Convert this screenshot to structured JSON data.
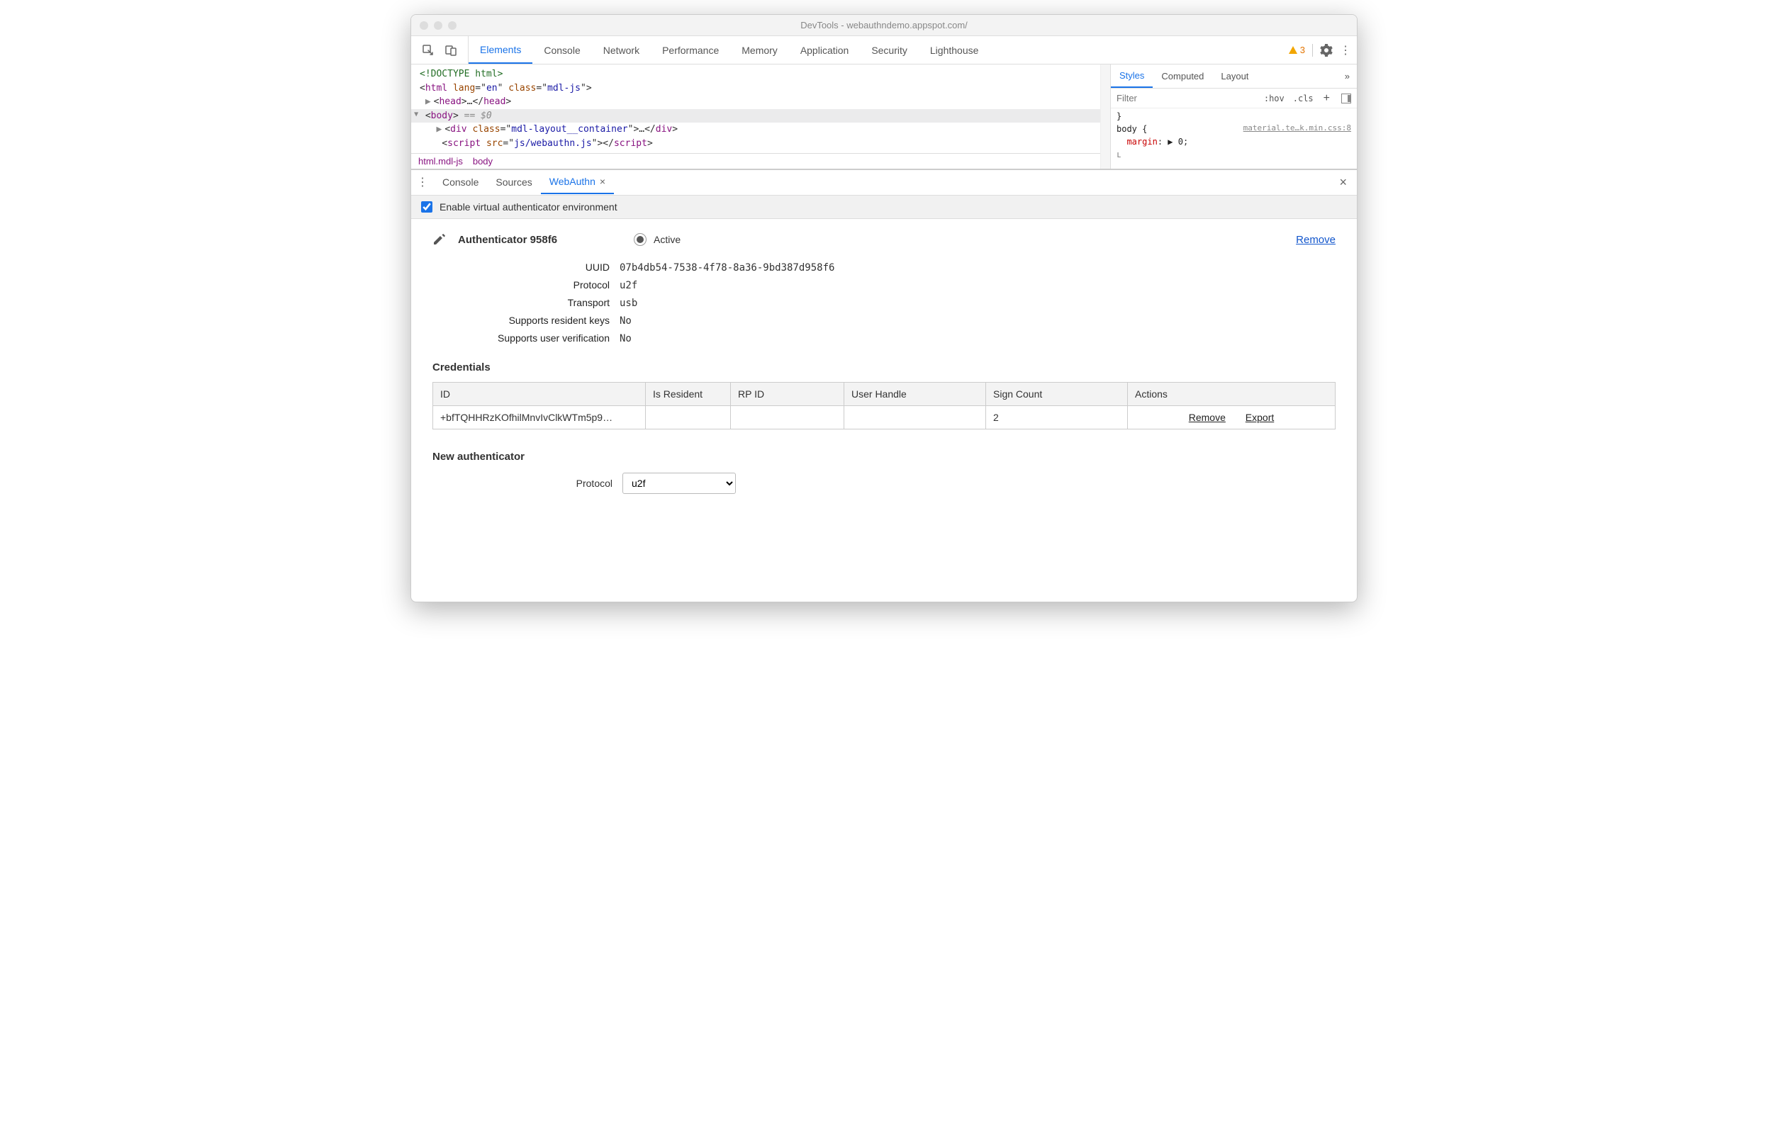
{
  "window": {
    "title": "DevTools - webauthndemo.appspot.com/"
  },
  "toolbar": {
    "tabs": [
      "Elements",
      "Console",
      "Network",
      "Performance",
      "Memory",
      "Application",
      "Security",
      "Lighthouse"
    ],
    "active": "Elements",
    "warning_count": "3"
  },
  "dom": {
    "line1": "<!DOCTYPE html>",
    "html_lang": "en",
    "html_class": "mdl-js",
    "body_sel": "== $0",
    "div_class": "mdl-layout__container",
    "script_src": "js/webauthn.js"
  },
  "breadcrumb": [
    "html.mdl-js",
    "body"
  ],
  "styles": {
    "tabs": [
      "Styles",
      "Computed",
      "Layout"
    ],
    "active": "Styles",
    "filter_placeholder": "Filter",
    "hov": ":hov",
    "cls": ".cls",
    "source": "material.te…k.min.css:8",
    "selector": "body",
    "prop": "margin",
    "val": "▶ 0"
  },
  "drawer": {
    "tabs": [
      "Console",
      "Sources",
      "WebAuthn"
    ],
    "active": "WebAuthn",
    "enable_label": "Enable virtual authenticator environment"
  },
  "auth": {
    "title": "Authenticator 958f6",
    "active_label": "Active",
    "remove": "Remove",
    "kv": {
      "uuid_k": "UUID",
      "uuid_v": "07b4db54-7538-4f78-8a36-9bd387d958f6",
      "protocol_k": "Protocol",
      "protocol_v": "u2f",
      "transport_k": "Transport",
      "transport_v": "usb",
      "srk_k": "Supports resident keys",
      "srk_v": "No",
      "suv_k": "Supports user verification",
      "suv_v": "No"
    }
  },
  "cred": {
    "title": "Credentials",
    "headers": [
      "ID",
      "Is Resident",
      "RP ID",
      "User Handle",
      "Sign Count",
      "Actions"
    ],
    "row": {
      "id": "+bfTQHHRzKOfhilMnvIvClkWTm5p9…",
      "is_res": "",
      "rpid": "",
      "uh": "",
      "sign": "2"
    },
    "actions": {
      "remove": "Remove",
      "export": "Export"
    }
  },
  "newauth": {
    "title": "New authenticator",
    "protocol_k": "Protocol",
    "protocol_v": "u2f"
  }
}
